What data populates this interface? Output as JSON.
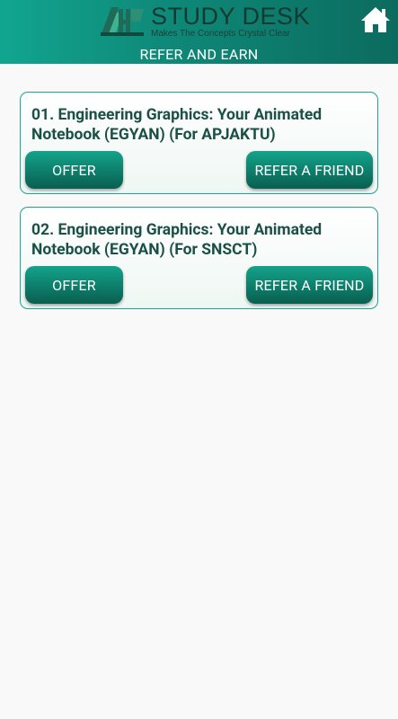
{
  "header": {
    "logo_title": "STUDY DESK",
    "logo_tagline": "Makes The Concepts Crystal Clear",
    "page_title": "REFER AND EARN",
    "home_icon": "home-icon"
  },
  "courses": [
    {
      "title": "01. Engineering Graphics: Your Animated Notebook (EGYAN) (For APJAKTU)",
      "offer_label": "OFFER",
      "refer_label": "REFER A FRIEND"
    },
    {
      "title": "02. Engineering Graphics: Your Animated Notebook (EGYAN) (For SNSCT)",
      "offer_label": "OFFER",
      "refer_label": "REFER A FRIEND"
    }
  ],
  "colors": {
    "header_start": "#11a58f",
    "header_end": "#0b6b5e",
    "button": "#0d7d6a",
    "card_border": "#1aa78e",
    "title_text": "#1a5046"
  }
}
